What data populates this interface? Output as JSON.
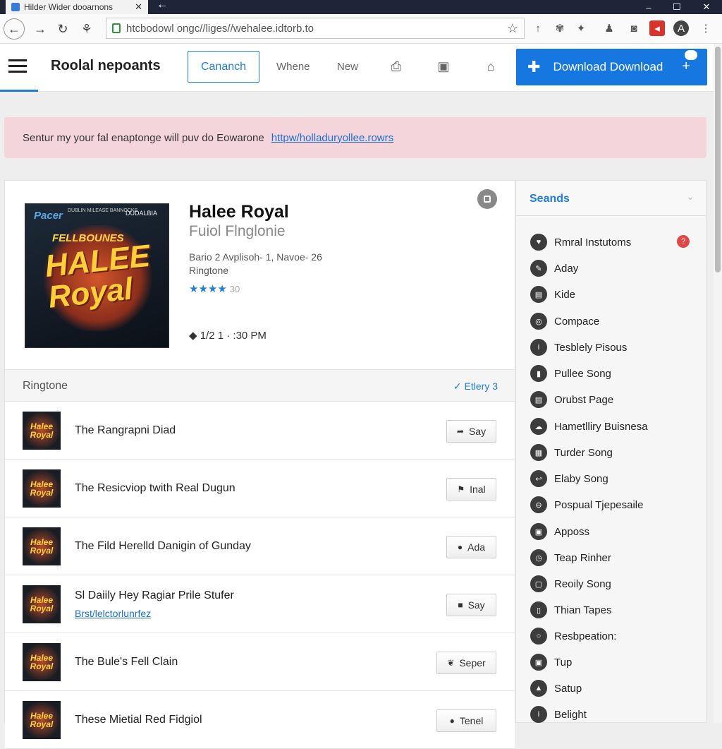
{
  "browser": {
    "tab_title": "Hilder Wider dooarnons",
    "url": "htcbodowl ongc//liges//wehalee.idtorb.to",
    "window_controls": [
      "–",
      "☐",
      "✕"
    ]
  },
  "site": {
    "title": "Roolal nepoants",
    "tab_active": "Cananch",
    "nav_links": [
      "Whene",
      "New"
    ],
    "download_label": "Download Download"
  },
  "notice": {
    "text": "Sentur my your fal enaptonge will puv do Eowarone",
    "link": "httpw/holladuryollee.rowrs"
  },
  "song": {
    "title": "Halee Royal",
    "subtitle": "Fuiol Flnglonie",
    "meta_line1": "Bario 2 Avplisoh- 1, Navoe- 26",
    "meta_line2": "Ringtone",
    "stars": "★★★★",
    "rating_count": "30",
    "time": "1/2 1 · :30 PM",
    "cover": {
      "small_brand": "Pacer",
      "top_text": "FELLBOUNES",
      "main_text": "HALEE Royal",
      "fine_print": "DUBLIN MILEASE BANNOCKS",
      "corner_text": "DUDALBIA"
    }
  },
  "ringtones": {
    "heading": "Ringtone",
    "link": "Etlery 3",
    "items": [
      {
        "name": "The Rangrapni Diad",
        "button": "Say",
        "icon": "share-icon"
      },
      {
        "name": "The Resicviop twith Real Dugun",
        "button": "Inal",
        "icon": "flag-icon"
      },
      {
        "name": "The Fild Herelld Danigin of Gunday",
        "button": "Ada",
        "icon": "apple-icon"
      },
      {
        "name": "Sl Daiily Hey Ragiar Prile Stufer",
        "sublink": "Brst/lelctorlunrfez",
        "button": "Say",
        "icon": "chat-icon"
      },
      {
        "name": "The Bule's Fell Clain",
        "button": "Seper",
        "icon": "bird-icon"
      },
      {
        "name": "These Mietial Red Fidgiol",
        "button": "Tenel",
        "icon": "apple-icon"
      }
    ]
  },
  "sidebar": {
    "heading": "Seands",
    "badge": "?",
    "items": [
      "Rmral Instutoms",
      "Aday",
      "Kide",
      "Compace",
      "Tesblely Pisous",
      "Pullee Song",
      "Orubst Page",
      "Hametlliry Buisnesa",
      "Turder Song",
      "Elaby Song",
      "Pospual Tjepesaile",
      "Apposs",
      "Teap Rinher",
      "Reoily Song",
      "Thian Tapes",
      "Resbpeation:",
      "Tup",
      "Satup",
      "Belight"
    ]
  },
  "colors": {
    "accent": "#1677e0",
    "notice_bg": "#f5d5dc",
    "badge": "#e04747"
  }
}
